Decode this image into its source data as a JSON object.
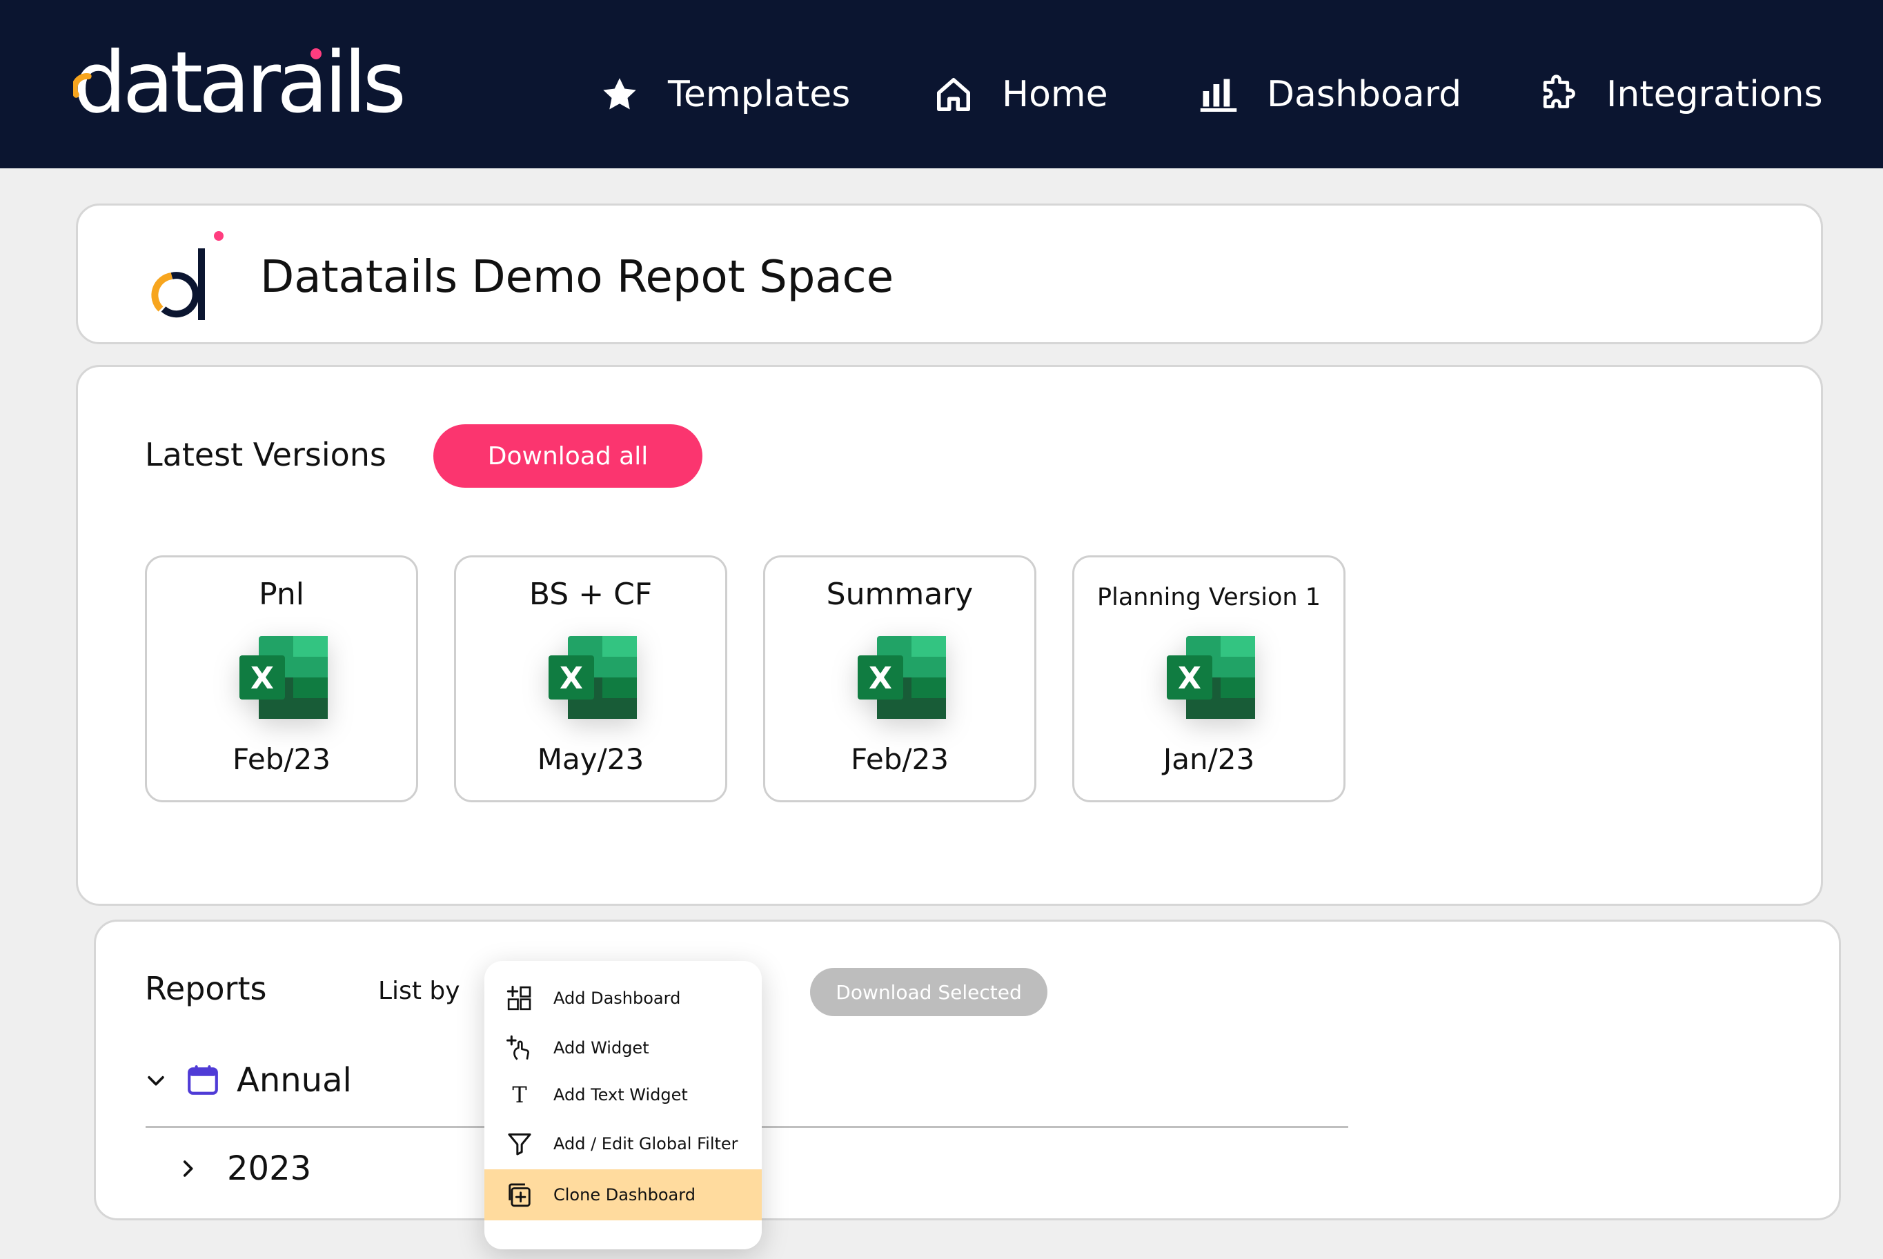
{
  "brand": {
    "logo_text": "datarails",
    "accent_orange": "#f7a51e",
    "accent_pink": "#ff3d7f",
    "nav_bg": "#0b1530"
  },
  "nav": {
    "items": [
      {
        "label": "Templates",
        "icon": "star-icon"
      },
      {
        "label": "Home",
        "icon": "home-icon"
      },
      {
        "label": "Dashboard",
        "icon": "bar-chart-icon"
      },
      {
        "label": "Integrations",
        "icon": "puzzle-icon"
      }
    ]
  },
  "space": {
    "title": "Datatails Demo Repot Space"
  },
  "versions": {
    "title": "Latest Versions",
    "download_all_label": "Download all",
    "files": [
      {
        "name": "Pnl",
        "date": "Feb/23"
      },
      {
        "name": "BS + CF",
        "date": "May/23"
      },
      {
        "name": "Summary",
        "date": "Feb/23"
      },
      {
        "name": "Planning Version 1",
        "date": "Jan/23"
      }
    ],
    "excel_icon_letter": "X"
  },
  "reports": {
    "title": "Reports",
    "list_by_label": "List by",
    "download_selected_label": "Download Selected",
    "groups": [
      {
        "label": "Annual",
        "children": [
          {
            "label": "2023"
          }
        ]
      }
    ]
  },
  "menu": {
    "items": [
      {
        "label": "Add Dashboard",
        "icon": "add-dashboard-icon"
      },
      {
        "label": "Add Widget",
        "icon": "add-widget-icon"
      },
      {
        "label": "Add Text Widget",
        "icon": "text-icon",
        "glyph": "T"
      },
      {
        "label": "Add / Edit Global Filter",
        "icon": "filter-icon"
      },
      {
        "label": "Clone Dashboard",
        "icon": "clone-icon",
        "highlighted": true
      }
    ]
  }
}
